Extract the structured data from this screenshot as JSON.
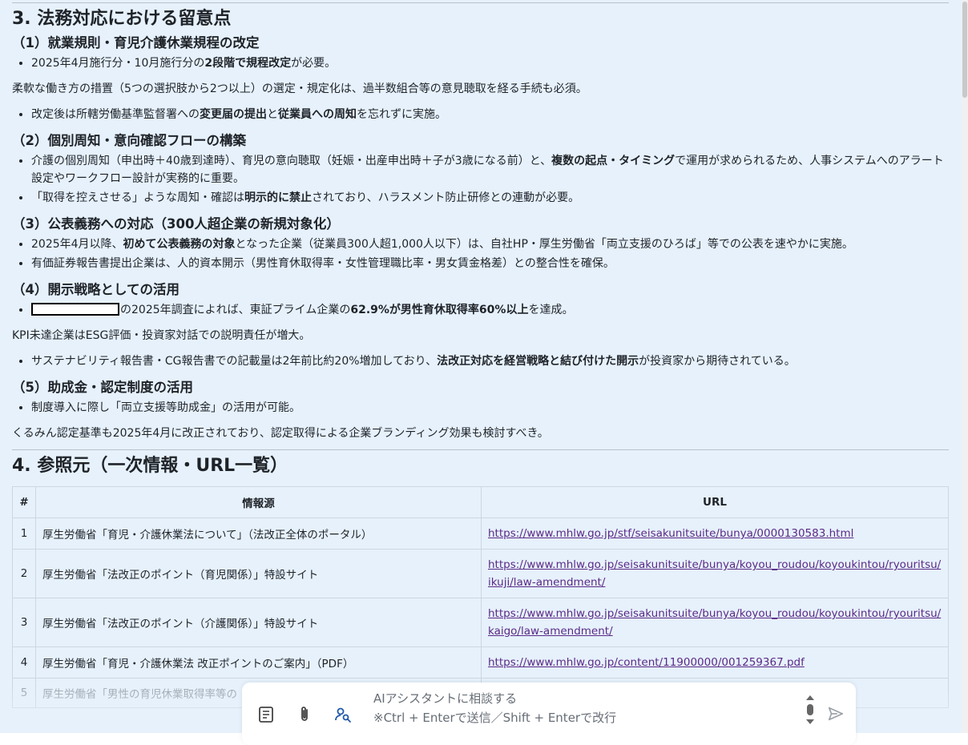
{
  "section3": {
    "heading": "3. 法務対応における留意点",
    "sub1": {
      "title": "（1）就業規則・育児介護休業規程の改定",
      "b1_pre": "2025年4月施行分・10月施行分の",
      "b1_bold": "2段階で規程改定",
      "b1_post": "が必要。",
      "para": "柔軟な働き方の措置（5つの選択肢から2つ以上）の選定・規定化は、過半数組合等の意見聴取を経る手続も必須。",
      "b2_pre": "改定後は所轄労働基準監督署への",
      "b2_bold1": "変更届の提出",
      "b2_mid": "と",
      "b2_bold2": "従業員への周知",
      "b2_post": "を忘れずに実施。"
    },
    "sub2": {
      "title": "（2）個別周知・意向確認フローの構築",
      "b1_pre": "介護の個別周知（申出時＋40歳到達時）、育児の意向聴取（妊娠・出産申出時＋子が3歳になる前）と、",
      "b1_bold": "複数の起点・タイミング",
      "b1_post": "で運用が求められるため、人事システムへのアラート設定やワークフロー設計が実務的に重要。",
      "b2_pre": "「取得を控えさせる」ような周知・確認は",
      "b2_bold": "明示的に禁止",
      "b2_post": "されており、ハラスメント防止研修との連動が必要。"
    },
    "sub3": {
      "title": "（3）公表義務への対応（300人超企業の新規対象化）",
      "b1_pre": "2025年4月以降、",
      "b1_bold": "初めて公表義務の対象",
      "b1_post": "となった企業（従業員300人超1,000人以下）は、自社HP・厚生労働省「両立支援のひろば」等での公表を速やかに実施。",
      "b2": "有価証券報告書提出企業は、人的資本開示（男性育休取得率・女性管理職比率・男女賃金格差）との整合性を確保。"
    },
    "sub4": {
      "title": "（4）開示戦略としての活用",
      "b1_pre": "の2025年調査によれば、東証プライム企業の",
      "b1_bold": "62.9%が男性育休取得率60%以上",
      "b1_post": "を達成。",
      "para": "KPI未達企業はESG評価・投資家対話での説明責任が増大。",
      "b2_pre": "サステナビリティ報告書・CG報告書での記載量は2年前比約20%増加しており、",
      "b2_bold": "法改正対応を経営戦略と結び付けた開示",
      "b2_post": "が投資家から期待されている。"
    },
    "sub5": {
      "title": "（5）助成金・認定制度の活用",
      "b1": "制度導入に際し「両立支援等助成金」の活用が可能。",
      "para": "くるみん認定基準も2025年4月に改正されており、認定取得による企業ブランディング効果も検討すべき。"
    }
  },
  "section4": {
    "heading": "4. 参照元（一次情報・URL一覧）",
    "columns": [
      "#",
      "情報源",
      "URL"
    ],
    "rows": [
      {
        "num": "1",
        "source": "厚生労働省「育児・介護休業法について」（法改正全体のポータル）",
        "url": "https://www.mhlw.go.jp/stf/seisakunitsuite/bunya/0000130583.html"
      },
      {
        "num": "2",
        "source": "厚生労働省「法改正のポイント（育児関係）」特設サイト",
        "url": "https://www.mhlw.go.jp/seisakunitsuite/bunya/koyou_roudou/koyoukintou/ryouritsu/ikuji/law-amendment/"
      },
      {
        "num": "3",
        "source": "厚生労働省「法改正のポイント（介護関係）」特設サイト",
        "url": "https://www.mhlw.go.jp/seisakunitsuite/bunya/koyou_roudou/koyoukintou/ryouritsu/kaigo/law-amendment/"
      },
      {
        "num": "4",
        "source": "厚生労働省「育児・介護休業法 改正ポイントのご案内」（PDF）",
        "url": "https://www.mhlw.go.jp/content/11900000/001259367.pdf"
      },
      {
        "num": "5",
        "source": "厚生労働省「男性の育児休業取得率等の",
        "url": ""
      }
    ]
  },
  "chat": {
    "placeholder_line1": "AIアシスタントに相談する",
    "placeholder_line2": "※Ctrl + Enterで送信／Shift + Enterで改行",
    "icons": [
      "document-icon",
      "paperclip-icon",
      "person-search-icon",
      "send-icon"
    ]
  }
}
